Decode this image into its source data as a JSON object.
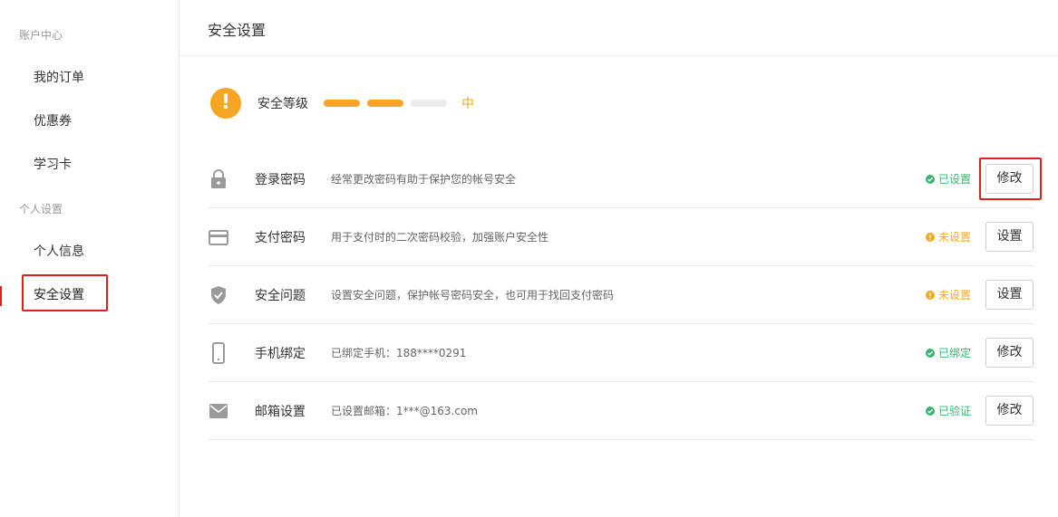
{
  "sidebar": {
    "groups": [
      {
        "title": "账户中心",
        "items": [
          {
            "label": "我的订单"
          },
          {
            "label": "优惠券"
          },
          {
            "label": "学习卡"
          }
        ]
      },
      {
        "title": "个人设置",
        "items": [
          {
            "label": "个人信息"
          },
          {
            "label": "安全设置",
            "active": true
          }
        ]
      }
    ]
  },
  "header": {
    "title": "安全设置"
  },
  "security_level": {
    "label": "安全等级",
    "level_text": "中",
    "filled_segments": 2,
    "total_segments": 3,
    "icon": "exclamation-icon"
  },
  "rows": [
    {
      "icon": "lock-icon",
      "title": "登录密码",
      "desc": "经常更改密码有助于保护您的帐号安全",
      "status": "已设置",
      "status_type": "ok",
      "button": "修改"
    },
    {
      "icon": "credit-card-icon",
      "title": "支付密码",
      "desc": "用于支付时的二次密码校验，加强账户安全性",
      "status": "未设置",
      "status_type": "warn",
      "button": "设置"
    },
    {
      "icon": "shield-check-icon",
      "title": "安全问题",
      "desc": "设置安全问题，保护帐号密码安全，也可用于找回支付密码",
      "status": "未设置",
      "status_type": "warn",
      "button": "设置"
    },
    {
      "icon": "phone-icon",
      "title": "手机绑定",
      "desc": "已绑定手机：188****0291",
      "status": "已绑定",
      "status_type": "ok",
      "button": "修改"
    },
    {
      "icon": "mail-icon",
      "title": "邮箱设置",
      "desc": "已设置邮箱：1***@163.com",
      "status": "已验证",
      "status_type": "ok",
      "button": "修改"
    }
  ],
  "colors": {
    "accent": "#f5a623",
    "ok": "#3cb371",
    "highlight": "#e0201a"
  }
}
